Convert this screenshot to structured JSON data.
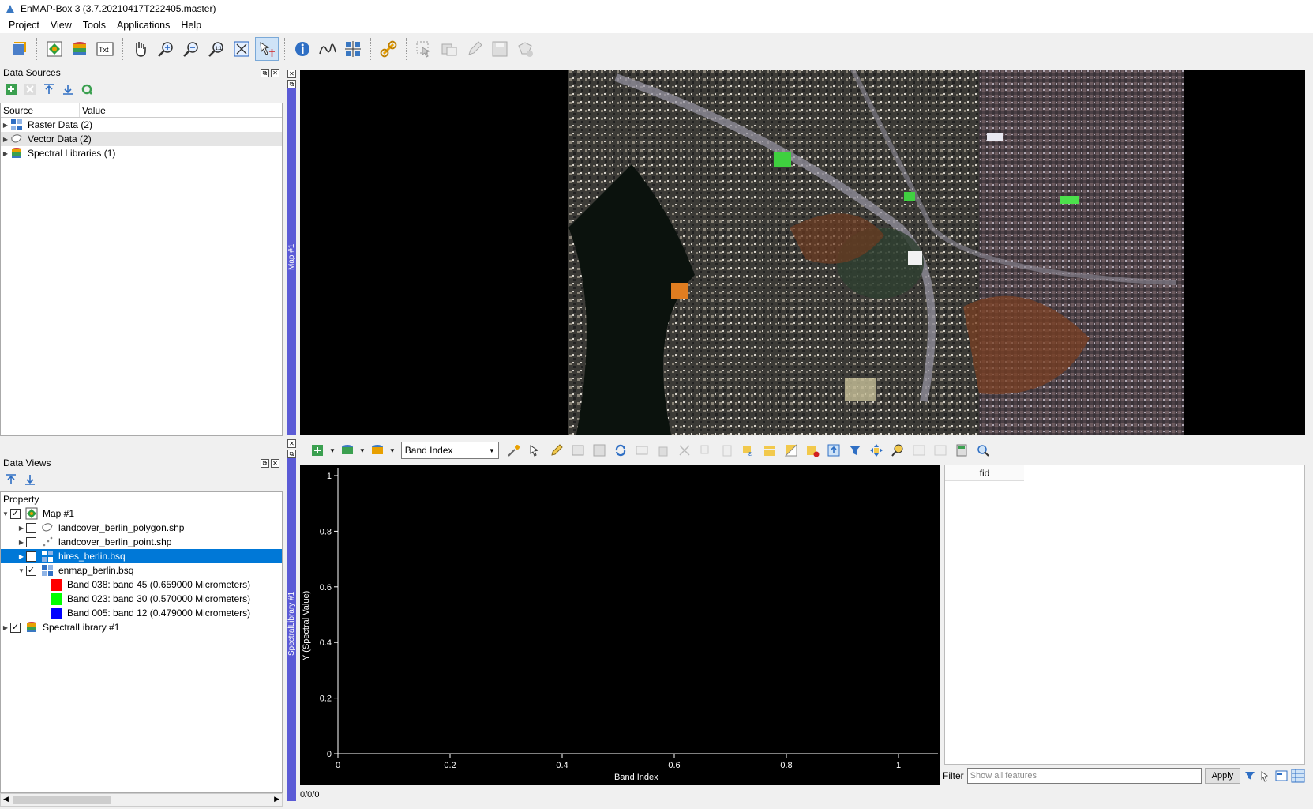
{
  "window": {
    "title": "EnMAP-Box 3 (3.7.20210417T222405.master)"
  },
  "menu": [
    "Project",
    "View",
    "Tools",
    "Applications",
    "Help"
  ],
  "data_sources": {
    "title": "Data Sources",
    "columns": [
      "Source",
      "Value"
    ],
    "items": [
      {
        "label": "Raster Data (2)",
        "icon": "raster-icon"
      },
      {
        "label": "Vector Data (2)",
        "icon": "vector-icon"
      },
      {
        "label": "Spectral Libraries (1)",
        "icon": "spectral-library-icon"
      }
    ]
  },
  "data_views": {
    "title": "Data Views",
    "columns": [
      "Property"
    ],
    "map": {
      "label": "Map #1",
      "checked": true
    },
    "layers": [
      {
        "label": "landcover_berlin_polygon.shp",
        "checked": false,
        "icon": "polygon-layer-icon"
      },
      {
        "label": "landcover_berlin_point.shp",
        "checked": false,
        "icon": "point-layer-icon"
      },
      {
        "label": "hires_berlin.bsq",
        "checked": false,
        "selected": true,
        "icon": "raster-icon"
      },
      {
        "label": "enmap_berlin.bsq",
        "checked": true,
        "icon": "raster-icon"
      }
    ],
    "bands": [
      {
        "label": "Band 038: band 45 (0.659000 Micrometers)",
        "color": "#ff0000"
      },
      {
        "label": "Band 023: band 30 (0.570000 Micrometers)",
        "color": "#00ff00"
      },
      {
        "label": "Band 005: band 12 (0.479000 Micrometers)",
        "color": "#0000ff"
      }
    ],
    "spectral_library": {
      "label": "SpectralLibrary #1",
      "checked": true
    }
  },
  "map_view": {
    "tab_label": "Map #1"
  },
  "spectral_view": {
    "tab_label": "SpectralLibrary #1",
    "x_unit_combo": "Band Index",
    "plot": {
      "xlabel": "Band Index",
      "ylabel": "Y (Spectral Value)",
      "xticks": [
        "0",
        "0.2",
        "0.4",
        "0.6",
        "0.8",
        "1"
      ],
      "yticks": [
        "0",
        "0.2",
        "0.4",
        "0.6",
        "0.8",
        "1"
      ]
    },
    "attribute_table": {
      "column": "fid"
    },
    "filter": {
      "label": "Filter",
      "placeholder": "Show all features",
      "apply": "Apply"
    },
    "status": "0/0/0"
  },
  "colors": {
    "accent": "#0078d7",
    "dock_tab": "#5b5bd6",
    "plot_bg": "#000000"
  }
}
